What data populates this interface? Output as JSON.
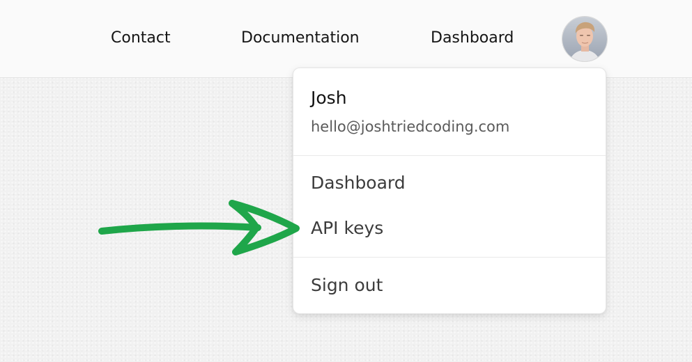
{
  "nav": {
    "links": [
      "Contact",
      "Documentation",
      "Dashboard"
    ]
  },
  "avatar": {
    "icon": "user-avatar-photo"
  },
  "menu": {
    "user_name": "Josh",
    "user_email": "hello@joshtriedcoding.com",
    "items": [
      "Dashboard",
      "API keys"
    ],
    "sign_out": "Sign out"
  },
  "annotation": {
    "arrow_color": "#1fa64a",
    "points_to": "API keys"
  },
  "colors": {
    "page_bg": "#f1f1f1",
    "nav_bg": "#fafafa",
    "menu_bg": "#ffffff",
    "arrow": "#1fa64a"
  }
}
